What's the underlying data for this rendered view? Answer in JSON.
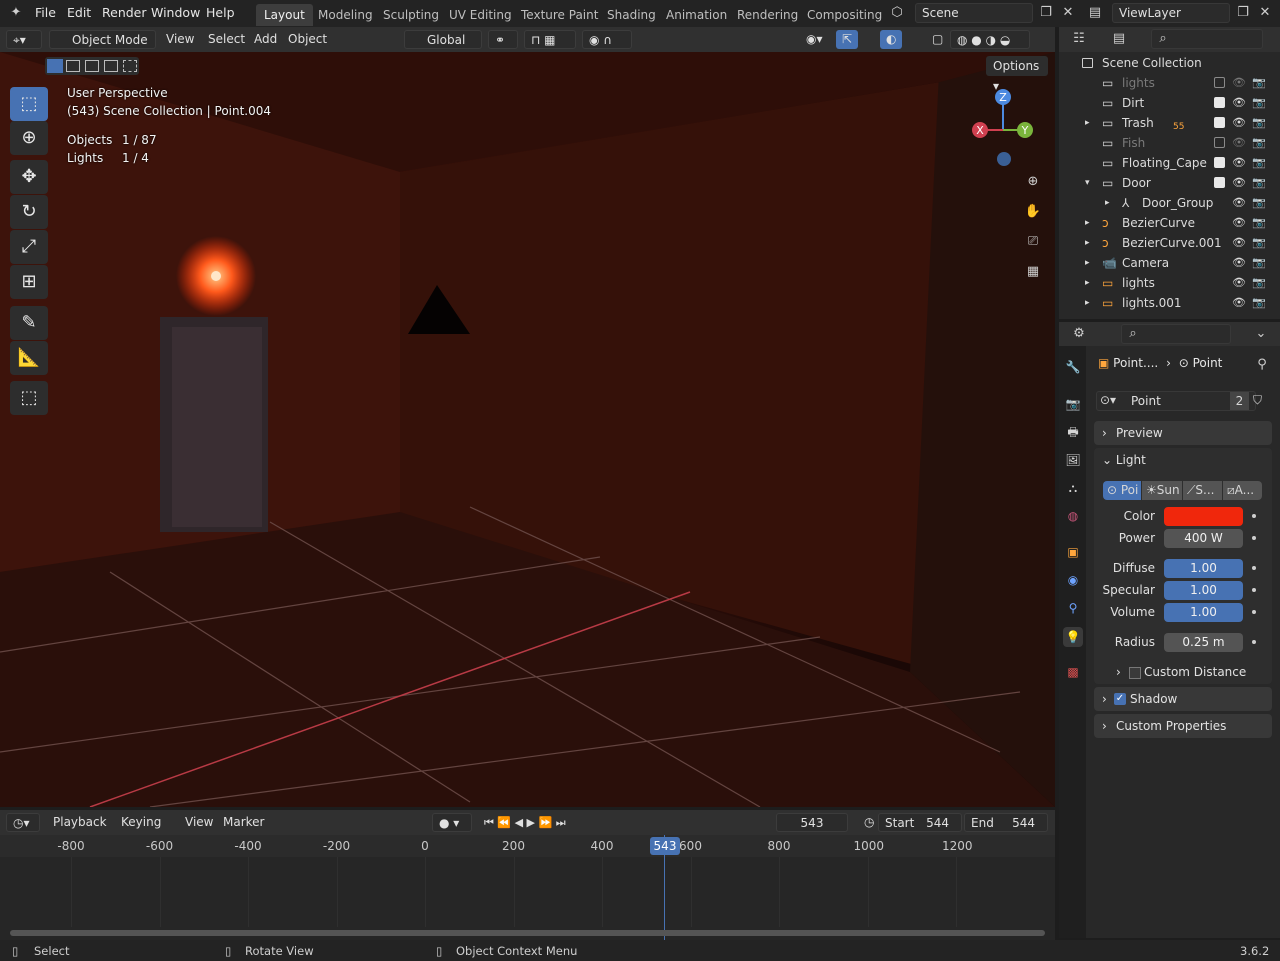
{
  "menu": {
    "file": "File",
    "edit": "Edit",
    "render": "Render",
    "window": "Window",
    "help": "Help"
  },
  "workspaces": [
    "Layout",
    "Modeling",
    "Sculpting",
    "UV Editing",
    "Texture Paint",
    "Shading",
    "Animation",
    "Rendering",
    "Compositing"
  ],
  "scene_name": "Scene",
  "view_layer": "ViewLayer",
  "viewport_header": {
    "mode": "Object Mode",
    "view": "View",
    "select": "Select",
    "add": "Add",
    "object": "Object",
    "orientation": "Global",
    "options": "Options"
  },
  "overlay": {
    "perspective": "User Perspective",
    "context": "(543) Scene Collection | Point.004",
    "objects_label": "Objects",
    "objects_value": "1 / 87",
    "lights_label": "Lights",
    "lights_value": "1 / 4"
  },
  "gizmo": {
    "x": "X",
    "y": "Y",
    "z": "Z"
  },
  "outliner": {
    "root": "Scene Collection",
    "items": [
      {
        "name": "lights",
        "dim": true,
        "checked": false
      },
      {
        "name": "Dirt",
        "dim": false,
        "checked": true
      },
      {
        "name": "Trash",
        "dim": false,
        "checked": true,
        "badge": "55"
      },
      {
        "name": "Fish",
        "dim": true,
        "checked": false
      },
      {
        "name": "Floating_Cape",
        "dim": false,
        "checked": true
      },
      {
        "name": "Door",
        "dim": false,
        "checked": true
      },
      {
        "name": "Door_Group",
        "dim": false
      },
      {
        "name": "BezierCurve",
        "dim": false
      },
      {
        "name": "BezierCurve.001",
        "dim": false
      },
      {
        "name": "Camera",
        "dim": false
      },
      {
        "name": "lights",
        "dim": false
      },
      {
        "name": "lights.001",
        "dim": false
      }
    ]
  },
  "properties": {
    "breadcrumb_object": "Point....",
    "breadcrumb_data": "Point",
    "datablock": "Point",
    "users": "2",
    "preview": "Preview",
    "light": "Light",
    "light_types": [
      "Poi",
      "Sun",
      "S...",
      "A..."
    ],
    "color_label": "Color",
    "color_value": "#f0270c",
    "power_label": "Power",
    "power_value": "400 W",
    "diffuse_label": "Diffuse",
    "diffuse_value": "1.00",
    "specular_label": "Specular",
    "specular_value": "1.00",
    "volume_label": "Volume",
    "volume_value": "1.00",
    "radius_label": "Radius",
    "radius_value": "0.25 m",
    "custom_distance": "Custom Distance",
    "shadow": "Shadow",
    "custom_props": "Custom Properties"
  },
  "timeline": {
    "playback": "Playback",
    "keying": "Keying",
    "view": "View",
    "marker": "Marker",
    "current_frame": "543",
    "start_label": "Start",
    "start": "544",
    "end_label": "End",
    "end": "544",
    "ticks": [
      "-800",
      "-600",
      "-400",
      "-200",
      "0",
      "200",
      "400",
      "600",
      "800",
      "1000",
      "1200"
    ],
    "playhead": "543"
  },
  "status": {
    "select": "Select",
    "rotate": "Rotate View",
    "context": "Object Context Menu",
    "version": "3.6.2"
  }
}
